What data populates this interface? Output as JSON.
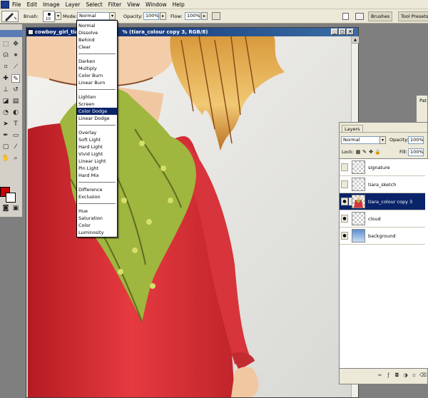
{
  "menu": [
    "File",
    "Edit",
    "Image",
    "Layer",
    "Select",
    "Filter",
    "View",
    "Window",
    "Help"
  ],
  "options": {
    "brush_label": "Brush:",
    "brush_size": "10",
    "mode_label": "Mode:",
    "mode_value": "Normal",
    "opacity_label": "Opacity:",
    "opacity_value": "100%",
    "flow_label": "Flow:",
    "flow_value": "100%",
    "palette_tabs": [
      "Brushes",
      "Tool Presets"
    ]
  },
  "document": {
    "title_left": "cowboy_girl_tia",
    "title_right": "% (tiara_colour copy 3, RGB/8)"
  },
  "blend_modes": {
    "items": [
      "Normal",
      "Dissolve",
      "Behind",
      "Clear",
      "Darken",
      "Multiply",
      "Color Burn",
      "Linear Burn",
      "Lighten",
      "Screen",
      "Color Dodge",
      "Linear Dodge",
      "Overlay",
      "Soft Light",
      "Hard Light",
      "Vivid Light",
      "Linear Light",
      "Pin Light",
      "Hard Mix",
      "Difference",
      "Exclusion",
      "Hue",
      "Saturation",
      "Color",
      "Luminosity"
    ],
    "selected": "Color Dodge"
  },
  "paths_tab": "Pat",
  "layers": {
    "tab_label": "Layers",
    "blend_mode": "Normal",
    "opacity_label": "Opacity:",
    "opacity_value": "100%",
    "lock_label": "Lock:",
    "fill_label": "Fill:",
    "fill_value": "100%",
    "items": [
      {
        "name": "signature",
        "visible": false,
        "active": false
      },
      {
        "name": "tiara_sketch",
        "visible": false,
        "active": false
      },
      {
        "name": "tiara_colour copy 3",
        "visible": true,
        "active": true
      },
      {
        "name": "cloud",
        "visible": true,
        "active": false
      },
      {
        "name": "background",
        "visible": true,
        "active": false
      }
    ]
  },
  "colors": {
    "foreground": "#c40000",
    "background": "#ffffff",
    "selection": "#0a246a"
  },
  "icons": {
    "eye": "eye-icon",
    "brush": "brush-icon",
    "lock": "lock-icon",
    "dropdown_arrow": "chevron-down-icon"
  }
}
